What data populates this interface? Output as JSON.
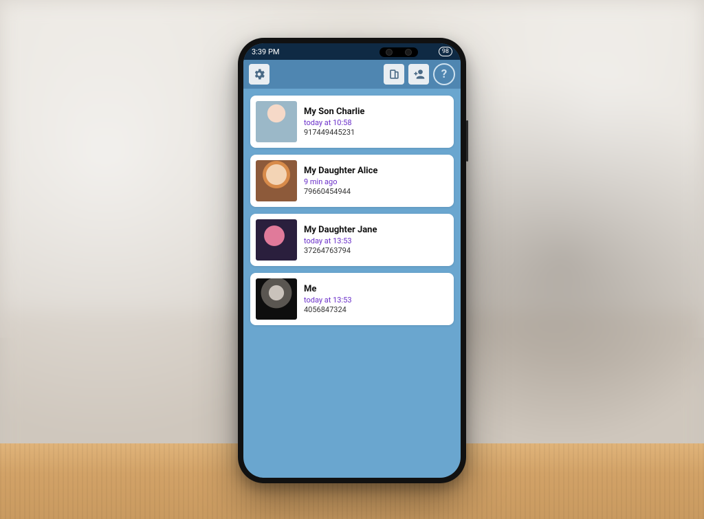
{
  "statusbar": {
    "time": "3:39 PM",
    "battery": "98"
  },
  "toolbar": {
    "settings_icon": "settings-icon",
    "devices_icon": "devices-icon",
    "add_person_icon": "add-person-icon",
    "help_icon": "help-icon",
    "help_label": "?"
  },
  "contacts": [
    {
      "name": "My Son Charlie",
      "time": "today at 10:58",
      "phone": "917449445231",
      "notif": "on",
      "avatar": "av0"
    },
    {
      "name": "My Daughter Alice",
      "time": "9 min ago",
      "phone": "79660454944",
      "notif": "off",
      "avatar": "av1"
    },
    {
      "name": "My Daughter Jane",
      "time": "today at 13:53",
      "phone": "37264763794",
      "notif": "on",
      "avatar": "av2"
    },
    {
      "name": "Me",
      "time": "today at 13:53",
      "phone": "4056847324",
      "notif": "off",
      "avatar": "av3"
    }
  ],
  "colors": {
    "accent": "#6aa6cf",
    "toolbar": "#4f86b1",
    "status": "#0f2a44",
    "time_text": "#6a2fc9",
    "notif_on": "#1aa84f",
    "notif_off": "#d9a79b"
  }
}
